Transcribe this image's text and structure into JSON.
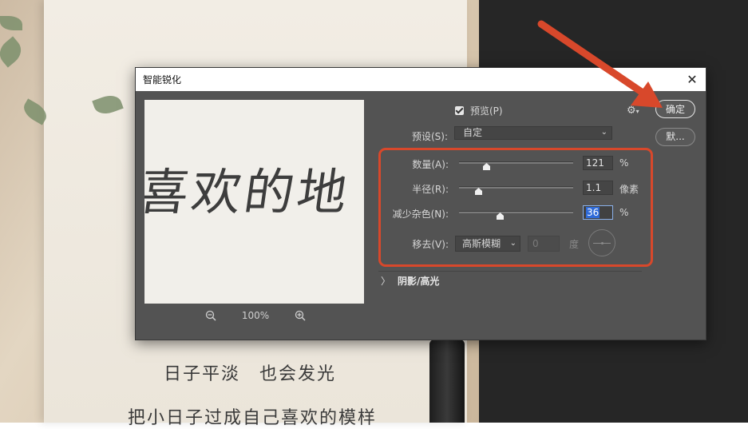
{
  "background": {
    "handwriting_line1": "日子平淡　也会发光",
    "handwriting_line2": "把小日子过成自己喜欢的模样"
  },
  "dialog": {
    "title": "智能锐化",
    "close_label": "✕",
    "preview_text": "喜欢的地",
    "zoom": {
      "level": "100%"
    },
    "preview_checkbox": {
      "label": "预览(P)",
      "checked": true
    },
    "ok_label": "确定",
    "default_label": "默...",
    "preset": {
      "label": "预设(S):",
      "value": "自定"
    },
    "amount": {
      "label": "数量(A):",
      "value": "121",
      "unit": "%",
      "slider_fraction": 0.24
    },
    "radius": {
      "label": "半径(R):",
      "value": "1.1",
      "unit": "像素",
      "slider_fraction": 0.17
    },
    "reduce_noise": {
      "label": "减少杂色(N):",
      "value": "36",
      "unit": "%",
      "slider_fraction": 0.36
    },
    "remove": {
      "label": "移去(V):",
      "value": "高斯模糊",
      "angle_value": "0",
      "angle_unit": "度"
    },
    "shadows_highlights": {
      "label": "阴影/高光"
    }
  },
  "colors": {
    "dialog_bg": "#535353",
    "annotation_red": "#d8482b",
    "selection_blue": "#2e6ad8"
  }
}
